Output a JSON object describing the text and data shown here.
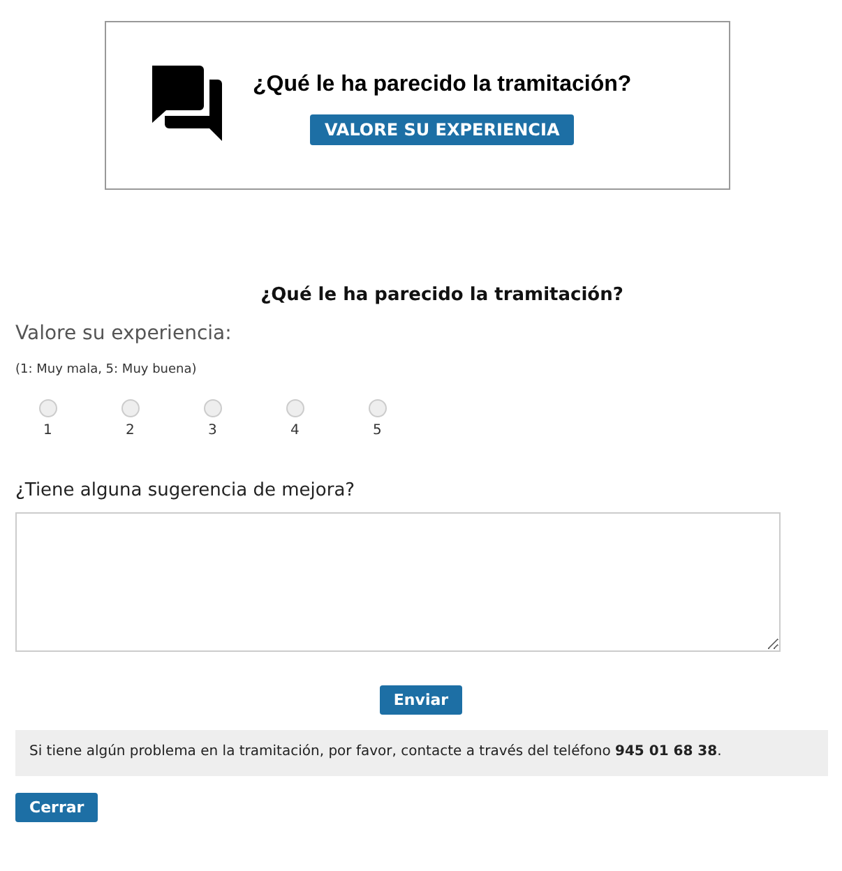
{
  "banner": {
    "question": "¿Qué le ha parecido la tramitación?",
    "button": "VALORE SU EXPERIENCIA"
  },
  "form": {
    "heading": "¿Qué le ha parecido la tramitación?",
    "rating_label": "Valore su experiencia:",
    "rating_hint": "(1: Muy mala, 5: Muy buena)",
    "ratings": [
      {
        "label": "1",
        "selected": false
      },
      {
        "label": "2",
        "selected": false
      },
      {
        "label": "3",
        "selected": false
      },
      {
        "label": "4",
        "selected": false
      },
      {
        "label": "5",
        "selected": false
      }
    ],
    "suggestion_label": "¿Tiene alguna sugerencia de mejora?",
    "submit": "Enviar"
  },
  "notice": "Si tiene algún problema en la tramitación, por favor, contacte a través del teléfono **945 01 68 38**.",
  "close": "Cerrar"
}
